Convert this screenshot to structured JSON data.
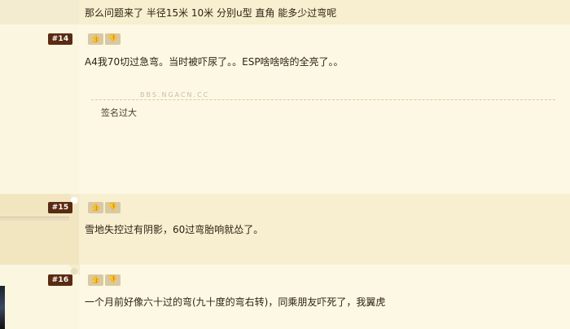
{
  "top_quote": "那么问题来了 半径15米 10米 分别u型 直角 能多少过弯呢",
  "posts": [
    {
      "floor": "#14",
      "text": "A4我70切过急弯。当时被吓尿了。。ESP啥啥啥的全亮了。。",
      "signature": "签名过大",
      "watermark": "BBS.NGACN.CC"
    },
    {
      "floor": "#15",
      "text": "雪地失控过有阴影，60过弯胎响就怂了。"
    },
    {
      "floor": "#16",
      "text": "一个月前好像六十过的弯(九十度的弯右转)，同乘朋友吓死了，我翼虎"
    }
  ],
  "vote": {
    "up_icon": "thumbs-up-icon",
    "down_icon": "thumbs-down-icon",
    "up_glyph": "👍",
    "down_glyph": "👎"
  },
  "colors": {
    "floor_badge": "#5a2a12",
    "vote_button": "#d9c9a1",
    "alt_row": "#f7efcf"
  }
}
